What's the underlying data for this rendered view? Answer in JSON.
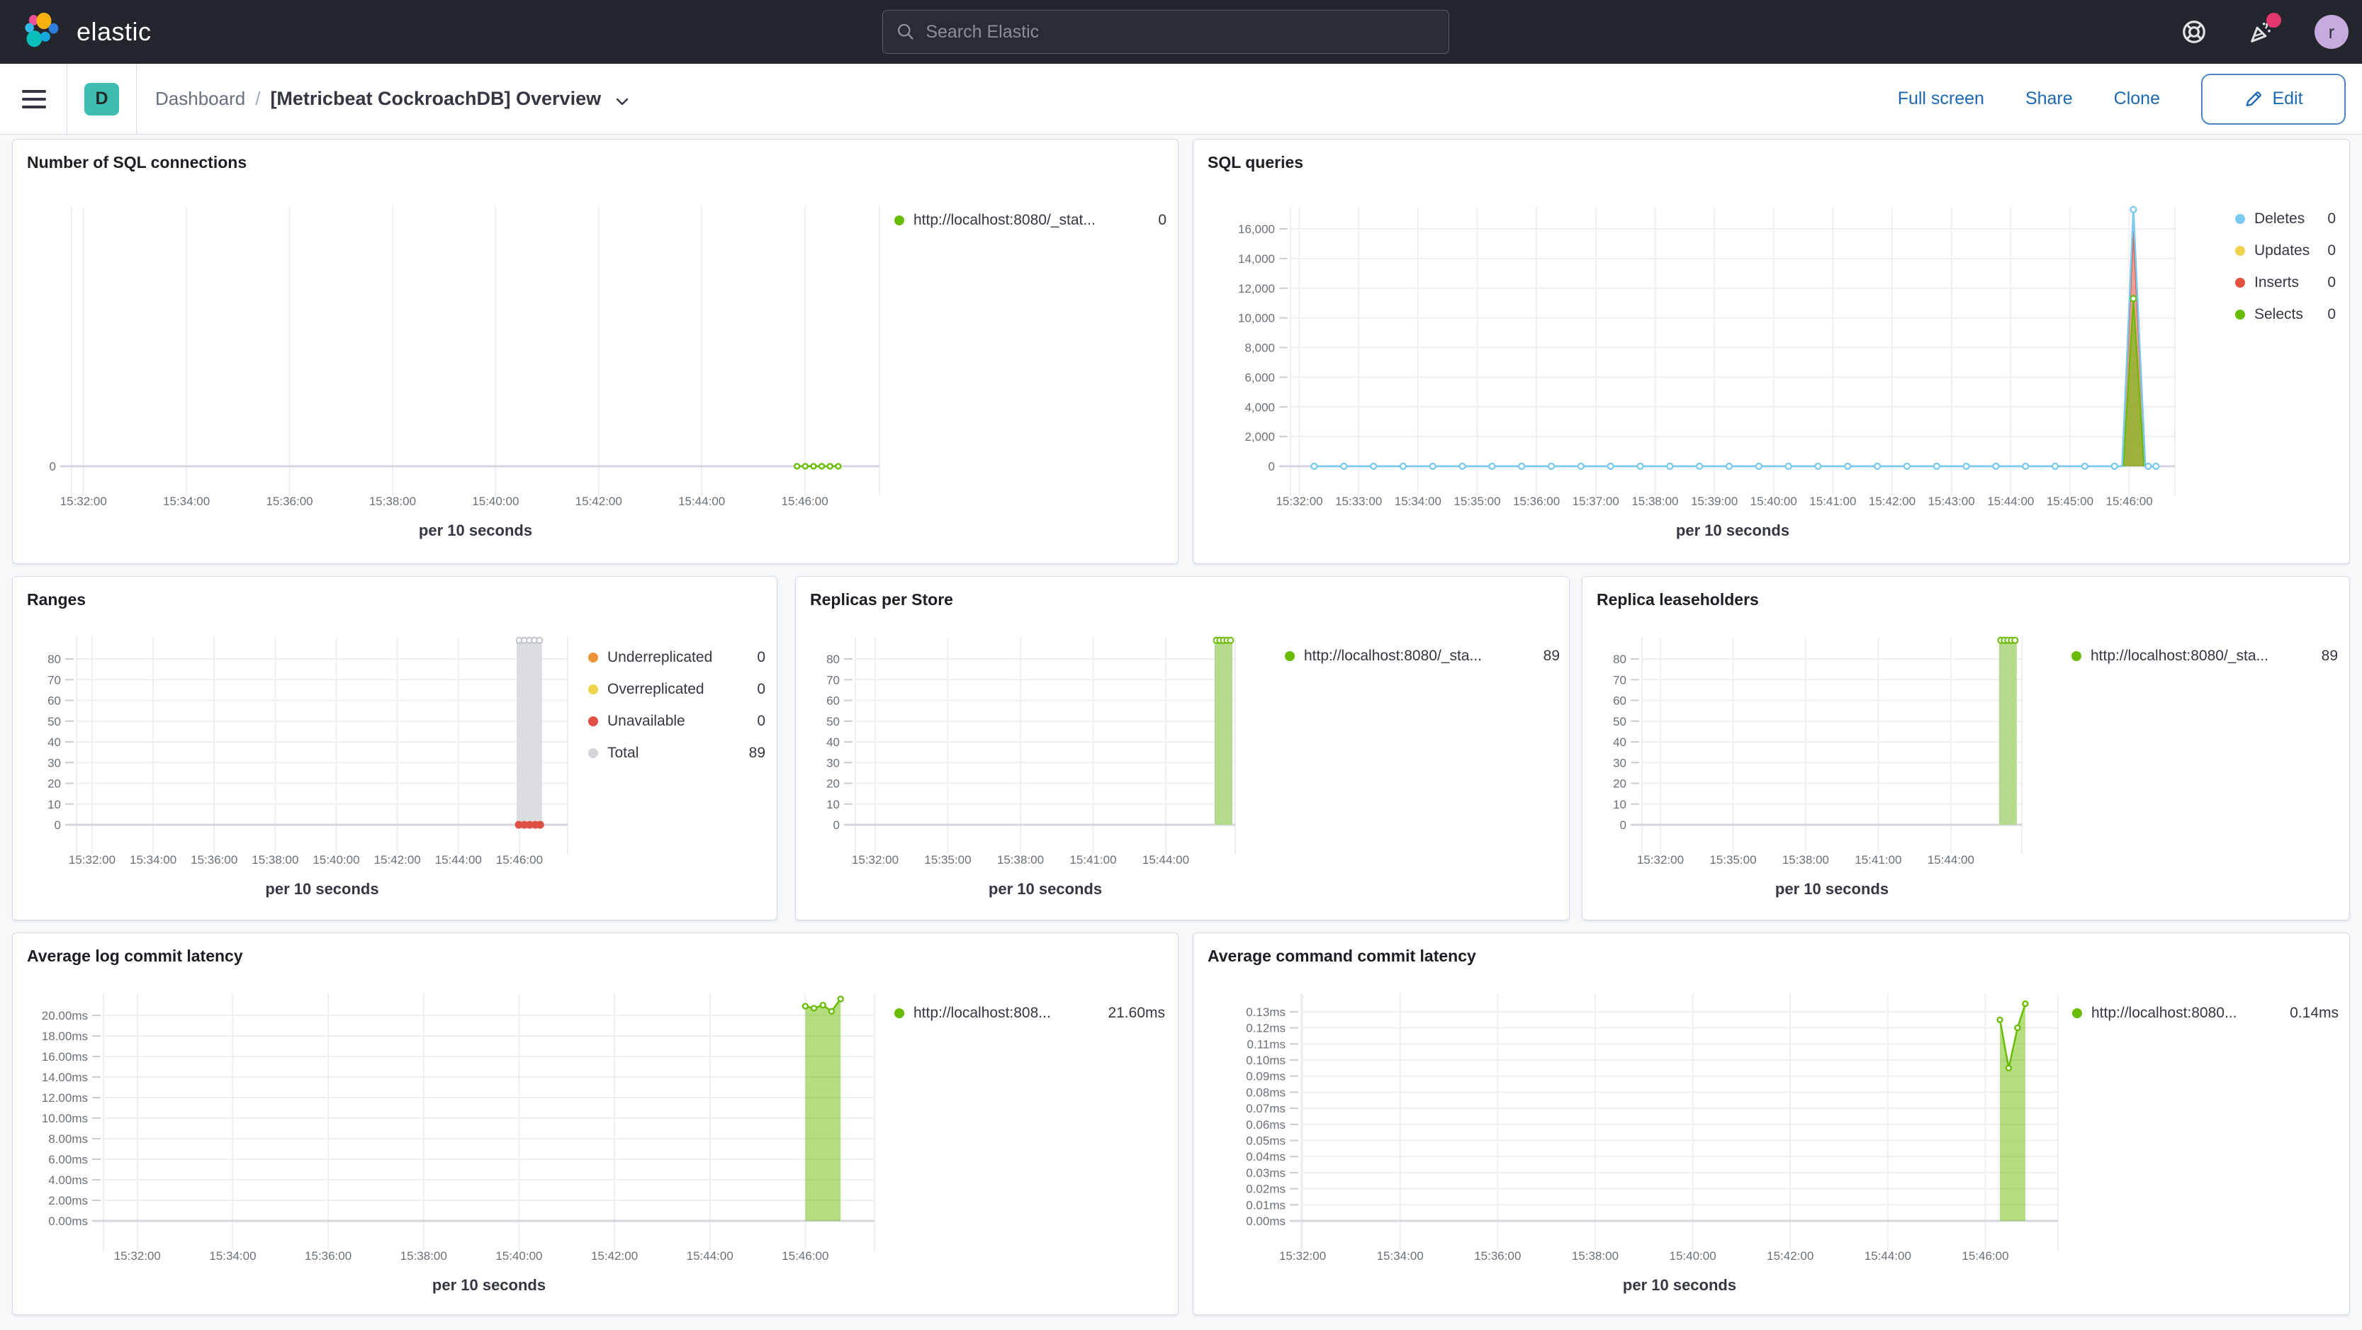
{
  "theme": {
    "header_bg": "#24262D",
    "link_blue": "#1C68B2",
    "space_badge_teal": "#3EBEB0",
    "avatar_purple": "#C6A9DD",
    "notification_pink": "#E4376D",
    "series_green": "#68BC00",
    "series_blue": "#79C9F0",
    "series_yellow": "#EFD24B",
    "series_red": "#E0533F",
    "series_orange": "#EC9436",
    "series_gray": "#D3D5DB"
  },
  "header": {
    "brand": "elastic",
    "search_placeholder": "Search Elastic",
    "avatar_initial": "r"
  },
  "nav": {
    "space_initial": "D",
    "breadcrumb_section": "Dashboard",
    "breadcrumb_sep": "/",
    "breadcrumb_current": "[Metricbeat CockroachDB] Overview",
    "full_screen": "Full screen",
    "share": "Share",
    "clone": "Clone",
    "edit": "Edit"
  },
  "panels": [
    {
      "title": "Number of SQL connections",
      "legend": [
        {
          "label": "http://localhost:8080/_stat...",
          "value": "0",
          "color": "#68BC00"
        }
      ],
      "chart": {
        "type": "line",
        "xlim": [
          31.77,
          47.45
        ],
        "ylim": [
          0,
          10
        ],
        "x_label": "per 10 seconds",
        "x_ticks": [
          {
            "t": 32,
            "label": "15:32:00"
          },
          {
            "t": 34,
            "label": "15:34:00"
          },
          {
            "t": 36,
            "label": "15:36:00"
          },
          {
            "t": 38,
            "label": "15:38:00"
          },
          {
            "t": 40,
            "label": "15:40:00"
          },
          {
            "t": 42,
            "label": "15:42:00"
          },
          {
            "t": 44,
            "label": "15:44:00"
          },
          {
            "t": 46,
            "label": "15:46:00"
          }
        ],
        "y_ticks": [
          {
            "v": 0,
            "label": "0"
          }
        ],
        "series": [
          {
            "name": "connections",
            "type": "line",
            "color": "#68BC00",
            "width": 2.5,
            "points": [
              [
                45.85,
                0
              ],
              [
                46.65,
                0
              ]
            ],
            "marker_range": {
              "from": 45.85,
              "to": 46.65,
              "step": 0.16
            },
            "marker": "hollow",
            "marker_r": 3.5
          }
        ]
      }
    },
    {
      "title": "SQL queries",
      "legend": [
        {
          "label": "Deletes",
          "value": "0",
          "color": "#79C9F0"
        },
        {
          "label": "Updates",
          "value": "0",
          "color": "#EFD24B"
        },
        {
          "label": "Inserts",
          "value": "0",
          "color": "#E0533F"
        },
        {
          "label": "Selects",
          "value": "0",
          "color": "#68BC00"
        }
      ],
      "chart": {
        "type": "line",
        "xlim": [
          31.85,
          46.77
        ],
        "ylim": [
          0,
          17433
        ],
        "x_label": "per 10 seconds",
        "x_ticks": [
          {
            "t": 32,
            "label": "15:32:00"
          },
          {
            "t": 33,
            "label": "15:33:00"
          },
          {
            "t": 34,
            "label": "15:34:00"
          },
          {
            "t": 35,
            "label": "15:35:00"
          },
          {
            "t": 36,
            "label": "15:36:00"
          },
          {
            "t": 37,
            "label": "15:37:00"
          },
          {
            "t": 38,
            "label": "15:38:00"
          },
          {
            "t": 39,
            "label": "15:39:00"
          },
          {
            "t": 40,
            "label": "15:40:00"
          },
          {
            "t": 41,
            "label": "15:41:00"
          },
          {
            "t": 42,
            "label": "15:42:00"
          },
          {
            "t": 43,
            "label": "15:43:00"
          },
          {
            "t": 44,
            "label": "15:44:00"
          },
          {
            "t": 45,
            "label": "15:45:00"
          },
          {
            "t": 46,
            "label": "15:46:00"
          }
        ],
        "y_ticks": [
          {
            "v": 0,
            "label": "0"
          },
          {
            "v": 2000,
            "label": "2,000"
          },
          {
            "v": 4000,
            "label": "4,000"
          },
          {
            "v": 6000,
            "label": "6,000"
          },
          {
            "v": 8000,
            "label": "8,000"
          },
          {
            "v": 10000,
            "label": "10,000"
          },
          {
            "v": 12000,
            "label": "12,000"
          },
          {
            "v": 14000,
            "label": "14,000"
          },
          {
            "v": 16000,
            "label": "16,000"
          }
        ],
        "series": [
          {
            "name": "inserts",
            "type": "area",
            "color": "#E0533F",
            "fill": "rgba(224,83,63,0.55)",
            "width": 2,
            "points": [
              [
                45.88,
                0
              ],
              [
                46.07,
                15800
              ],
              [
                46.27,
                0
              ]
            ]
          },
          {
            "name": "selects",
            "type": "area",
            "color": "#68BC00",
            "fill": "rgba(104,188,0,0.6)",
            "width": 2,
            "points": [
              [
                45.9,
                0
              ],
              [
                46.07,
                11300
              ],
              [
                46.25,
                0
              ]
            ],
            "markers": [
              [
                46.07,
                11300
              ]
            ],
            "marker": "hollow",
            "marker_r": 4
          },
          {
            "name": "deletes",
            "type": "line",
            "color": "#79C9F0",
            "width": 2.5,
            "points": [
              [
                32.2,
                0
              ],
              [
                45.88,
                0
              ],
              [
                46.07,
                17300
              ],
              [
                46.27,
                0
              ],
              [
                46.5,
                0
              ]
            ],
            "marker_range": {
              "from": 32.25,
              "to": 45.75,
              "step": 0.5
            },
            "markers": [
              [
                46.07,
                17300
              ],
              [
                46.32,
                0
              ],
              [
                46.45,
                0
              ]
            ],
            "marker": "hollow",
            "marker_r": 4
          }
        ]
      }
    },
    {
      "title": "Ranges",
      "legend": [
        {
          "label": "Underreplicated",
          "value": "0",
          "color": "#EC9436"
        },
        {
          "label": "Overreplicated",
          "value": "0",
          "color": "#F0D44C"
        },
        {
          "label": "Unavailable",
          "value": "0",
          "color": "#DF4F43"
        },
        {
          "label": "Total",
          "value": "89",
          "color": "#D3D5DB"
        }
      ],
      "chart": {
        "type": "bar",
        "xlim": [
          31.49,
          47.58
        ],
        "ylim": [
          0,
          90.6
        ],
        "x_label": "per 10 seconds",
        "x_ticks": [
          {
            "t": 32,
            "label": "15:32:00"
          },
          {
            "t": 34,
            "label": "15:34:00"
          },
          {
            "t": 36,
            "label": "15:36:00"
          },
          {
            "t": 38,
            "label": "15:38:00"
          },
          {
            "t": 40,
            "label": "15:40:00"
          },
          {
            "t": 42,
            "label": "15:42:00"
          },
          {
            "t": 44,
            "label": "15:44:00"
          },
          {
            "t": 46,
            "label": "15:46:00"
          }
        ],
        "y_ticks": [
          {
            "v": 0,
            "label": "0"
          },
          {
            "v": 10,
            "label": "10"
          },
          {
            "v": 20,
            "label": "20"
          },
          {
            "v": 30,
            "label": "30"
          },
          {
            "v": 40,
            "label": "40"
          },
          {
            "v": 50,
            "label": "50"
          },
          {
            "v": 60,
            "label": "60"
          },
          {
            "v": 70,
            "label": "70"
          },
          {
            "v": 80,
            "label": "80"
          }
        ],
        "series": [
          {
            "name": "total",
            "type": "bar",
            "color": "#DCDDE1",
            "t_from": 45.91,
            "t_to": 46.74,
            "v": 89,
            "top_markers": 5,
            "marker_color": "#BEC2C9"
          },
          {
            "name": "unavailable",
            "type": "dots",
            "color": "#DF4F43",
            "r": 5.5,
            "points": [
              [
                45.98,
                0
              ],
              [
                46.16,
                0
              ],
              [
                46.34,
                0
              ],
              [
                46.52,
                0
              ],
              [
                46.68,
                0
              ]
            ]
          }
        ]
      }
    },
    {
      "title": "Replicas per Store",
      "legend": [
        {
          "label": "http://localhost:8080/_sta...",
          "value": "89",
          "color": "#68BC00"
        }
      ],
      "chart": {
        "type": "bar",
        "xlim": [
          31.18,
          46.87
        ],
        "ylim": [
          0,
          90.6
        ],
        "x_label": "per 10 seconds",
        "x_ticks": [
          {
            "t": 32,
            "label": "15:32:00"
          },
          {
            "t": 35,
            "label": "15:35:00"
          },
          {
            "t": 38,
            "label": "15:38:00"
          },
          {
            "t": 41,
            "label": "15:41:00"
          },
          {
            "t": 44,
            "label": "15:44:00"
          }
        ],
        "y_ticks": [
          {
            "v": 0,
            "label": "0"
          },
          {
            "v": 10,
            "label": "10"
          },
          {
            "v": 20,
            "label": "20"
          },
          {
            "v": 30,
            "label": "30"
          },
          {
            "v": 40,
            "label": "40"
          },
          {
            "v": 50,
            "label": "50"
          },
          {
            "v": 60,
            "label": "60"
          },
          {
            "v": 70,
            "label": "70"
          },
          {
            "v": 80,
            "label": "80"
          }
        ],
        "series": [
          {
            "name": "replicas",
            "type": "bar",
            "color": "#B5DA8C",
            "t_from": 46.02,
            "t_to": 46.75,
            "v": 89,
            "top_markers": 5,
            "marker_color": "#68BC00"
          }
        ]
      }
    },
    {
      "title": "Replica leaseholders",
      "legend": [
        {
          "label": "http://localhost:8080/_sta...",
          "value": "89",
          "color": "#68BC00"
        }
      ],
      "chart": {
        "type": "bar",
        "xlim": [
          31.24,
          46.93
        ],
        "ylim": [
          0,
          90.6
        ],
        "x_label": "per 10 seconds",
        "x_ticks": [
          {
            "t": 32,
            "label": "15:32:00"
          },
          {
            "t": 35,
            "label": "15:35:00"
          },
          {
            "t": 38,
            "label": "15:38:00"
          },
          {
            "t": 41,
            "label": "15:41:00"
          },
          {
            "t": 44,
            "label": "15:44:00"
          }
        ],
        "y_ticks": [
          {
            "v": 0,
            "label": "0"
          },
          {
            "v": 10,
            "label": "10"
          },
          {
            "v": 20,
            "label": "20"
          },
          {
            "v": 30,
            "label": "30"
          },
          {
            "v": 40,
            "label": "40"
          },
          {
            "v": 50,
            "label": "50"
          },
          {
            "v": 60,
            "label": "60"
          },
          {
            "v": 70,
            "label": "70"
          },
          {
            "v": 80,
            "label": "80"
          }
        ],
        "series": [
          {
            "name": "leaseholders",
            "type": "bar",
            "color": "#B5DA8C",
            "t_from": 45.99,
            "t_to": 46.72,
            "v": 89,
            "top_markers": 5,
            "marker_color": "#68BC00"
          }
        ]
      }
    },
    {
      "title": "Average log commit latency",
      "legend": [
        {
          "label": "http://localhost:808...",
          "value": "21.60ms",
          "color": "#68BC00"
        }
      ],
      "chart": {
        "type": "area",
        "xlim": [
          31.29,
          47.45
        ],
        "ylim": [
          0,
          22.14
        ],
        "x_label": "per 10 seconds",
        "x_ticks": [
          {
            "t": 32,
            "label": "15:32:00"
          },
          {
            "t": 34,
            "label": "15:34:00"
          },
          {
            "t": 36,
            "label": "15:36:00"
          },
          {
            "t": 38,
            "label": "15:38:00"
          },
          {
            "t": 40,
            "label": "15:40:00"
          },
          {
            "t": 42,
            "label": "15:42:00"
          },
          {
            "t": 44,
            "label": "15:44:00"
          },
          {
            "t": 46,
            "label": "15:46:00"
          }
        ],
        "y_ticks": [
          {
            "v": 0,
            "label": "0.00ms"
          },
          {
            "v": 2,
            "label": "2.00ms"
          },
          {
            "v": 4,
            "label": "4.00ms"
          },
          {
            "v": 6,
            "label": "6.00ms"
          },
          {
            "v": 8,
            "label": "8.00ms"
          },
          {
            "v": 10,
            "label": "10.00ms"
          },
          {
            "v": 12,
            "label": "12.00ms"
          },
          {
            "v": 14,
            "label": "14.00ms"
          },
          {
            "v": 16,
            "label": "16.00ms"
          },
          {
            "v": 18,
            "label": "18.00ms"
          },
          {
            "v": 20,
            "label": "20.00ms"
          }
        ],
        "series": [
          {
            "name": "log-commit-latency",
            "type": "area",
            "color": "#68BC00",
            "fill": "rgba(104,188,0,0.5)",
            "width": 2.5,
            "points": [
              [
                46.0,
                20.9
              ],
              [
                46.18,
                20.7
              ],
              [
                46.37,
                21.0
              ],
              [
                46.55,
                20.4
              ],
              [
                46.74,
                21.6
              ]
            ],
            "markers": "points",
            "marker": "hollow",
            "marker_r": 3.5
          }
        ]
      }
    },
    {
      "title": "Average command commit latency",
      "legend": [
        {
          "label": "http://localhost:8080...",
          "value": "0.14ms",
          "color": "#68BC00"
        }
      ],
      "chart": {
        "type": "area",
        "xlim": [
          31.97,
          47.49
        ],
        "ylim": [
          0,
          0.1414
        ],
        "x_label": "per 10 seconds",
        "x_ticks": [
          {
            "t": 32,
            "label": "15:32:00"
          },
          {
            "t": 34,
            "label": "15:34:00"
          },
          {
            "t": 36,
            "label": "15:36:00"
          },
          {
            "t": 38,
            "label": "15:38:00"
          },
          {
            "t": 40,
            "label": "15:40:00"
          },
          {
            "t": 42,
            "label": "15:42:00"
          },
          {
            "t": 44,
            "label": "15:44:00"
          },
          {
            "t": 46,
            "label": "15:46:00"
          }
        ],
        "y_ticks": [
          {
            "v": 0,
            "label": "0.00ms"
          },
          {
            "v": 0.01,
            "label": "0.01ms"
          },
          {
            "v": 0.02,
            "label": "0.02ms"
          },
          {
            "v": 0.03,
            "label": "0.03ms"
          },
          {
            "v": 0.04,
            "label": "0.04ms"
          },
          {
            "v": 0.05,
            "label": "0.05ms"
          },
          {
            "v": 0.06,
            "label": "0.06ms"
          },
          {
            "v": 0.07,
            "label": "0.07ms"
          },
          {
            "v": 0.08,
            "label": "0.08ms"
          },
          {
            "v": 0.09,
            "label": "0.09ms"
          },
          {
            "v": 0.1,
            "label": "0.10ms"
          },
          {
            "v": 0.11,
            "label": "0.11ms"
          },
          {
            "v": 0.12,
            "label": "0.12ms"
          },
          {
            "v": 0.13,
            "label": "0.13ms"
          }
        ],
        "series": [
          {
            "name": "command-commit-latency",
            "type": "area",
            "color": "#68BC00",
            "fill": "rgba(104,188,0,0.5)",
            "width": 2.5,
            "points": [
              [
                46.3,
                0.125
              ],
              [
                46.48,
                0.095
              ],
              [
                46.66,
                0.12
              ],
              [
                46.82,
                0.135
              ]
            ],
            "markers": "points",
            "marker": "hollow",
            "marker_r": 3.5
          }
        ]
      }
    }
  ]
}
